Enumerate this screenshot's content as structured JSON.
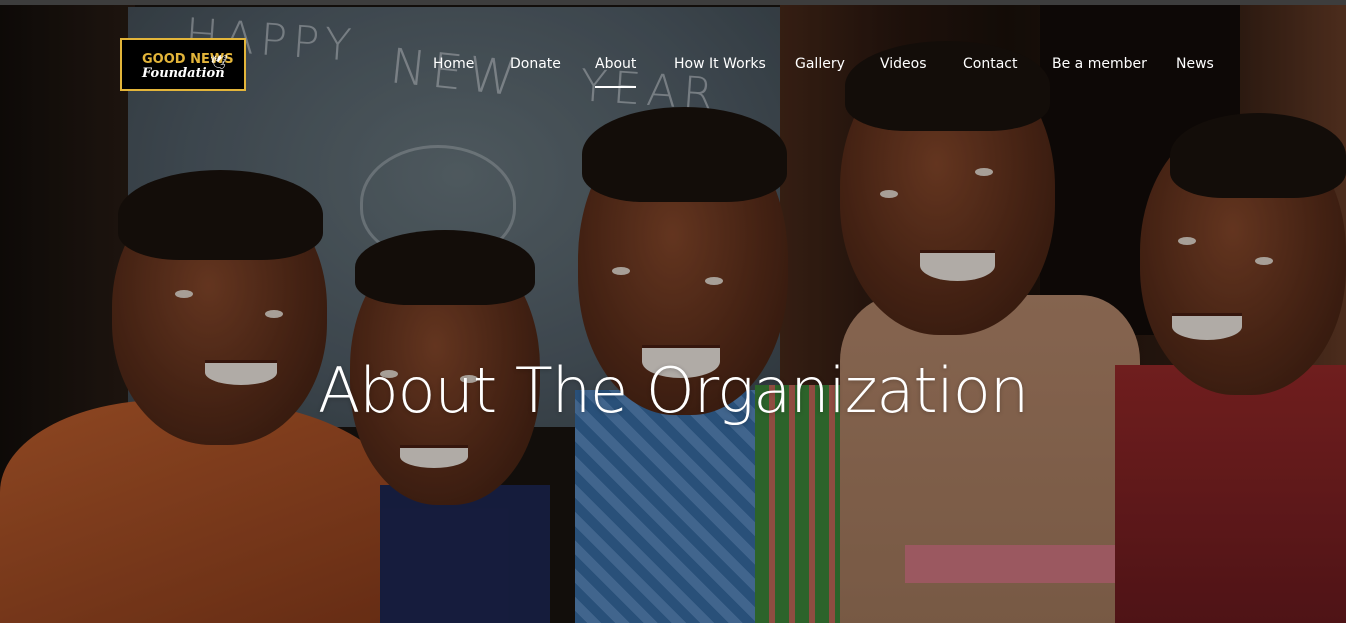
{
  "brand": {
    "logo_line1": "GOOD NEWS",
    "logo_line2": "Foundation",
    "accent_color": "#e3b53a"
  },
  "nav": {
    "items": [
      {
        "label": "Home"
      },
      {
        "label": "Donate"
      },
      {
        "label": "About",
        "active": true
      },
      {
        "label": "How It Works"
      },
      {
        "label": "Gallery"
      },
      {
        "label": "Videos"
      },
      {
        "label": "Contact"
      },
      {
        "label": "Be a member"
      },
      {
        "label": "News"
      }
    ]
  },
  "hero": {
    "title": "About The Organization",
    "chalkboard_text": [
      "HAPPY",
      "NEW",
      "YEAR"
    ]
  }
}
